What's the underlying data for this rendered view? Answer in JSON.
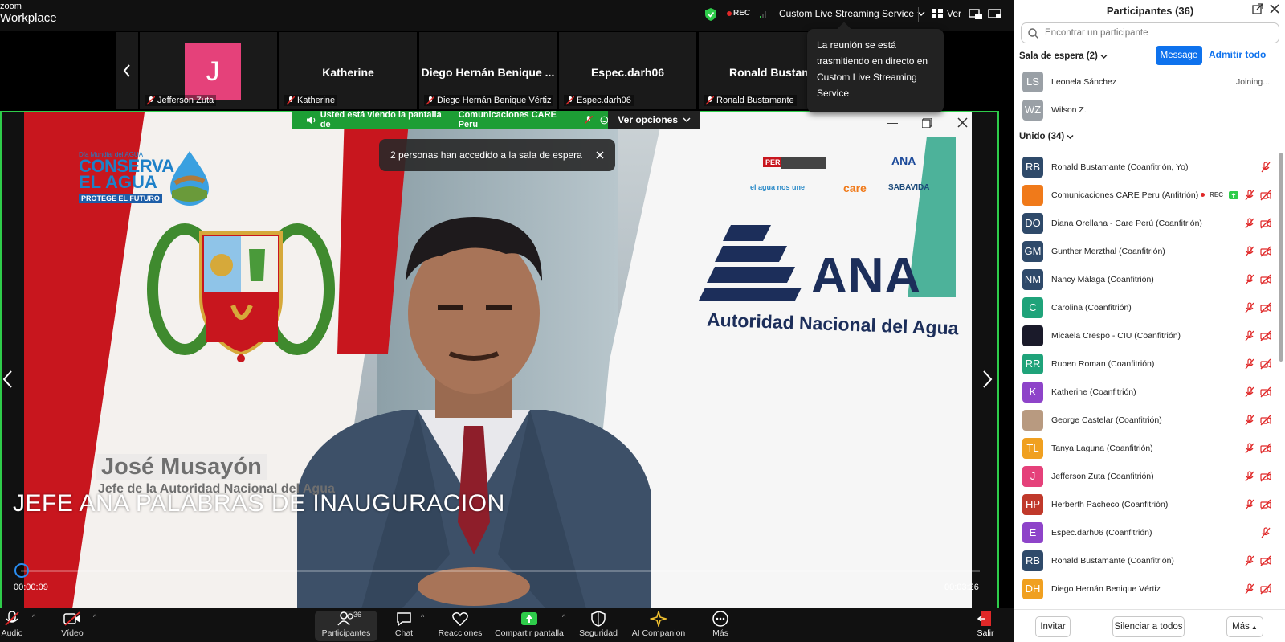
{
  "app": {
    "brand_line1": "zoom",
    "brand_line2": "Workplace"
  },
  "topbar": {
    "rec_label": "REC",
    "stream_label": "Custom Live Streaming Service",
    "view_label": "Ver"
  },
  "strip": {
    "tiles": [
      {
        "initial": "J",
        "label": "Jefferson Zuta"
      },
      {
        "name": "Katherine",
        "label": "Katherine"
      },
      {
        "name": "Diego Hernán Benique ...",
        "label": "Diego Hernán Benique Vértiz"
      },
      {
        "name": "Espec.darh06",
        "label": "Espec.darh06"
      },
      {
        "name": "Ronald Bustama",
        "label": "Ronald Bustamante"
      }
    ]
  },
  "tooltip": {
    "text": "La reunión se está trasmitiendo en directo en Custom Live Streaming Service"
  },
  "share": {
    "viewing_prefix": "Usted está viendo la pantalla de",
    "presenter": "Comunicaciones CARE Peru",
    "options_label": "Ver opciones",
    "toast": "2 personas han accedido a la sala de espera"
  },
  "video": {
    "logo_small": "Día Mundial del AGUA",
    "logo_line1": "CONSERVA",
    "logo_line2": "EL AGUA",
    "logo_line3": "PROTEGE EL FUTURO",
    "sponsor_peru": "PERÚ",
    "sponsor_ana_small": "ANA",
    "sponsor_care": "care",
    "sponsor_sabavida": "SABAVIDA",
    "sponsor_elagua": "el agua nos une",
    "ana_big": "ANA",
    "ana_sub": "Autoridad Nacional del Agua",
    "lower_name": "José Musayón",
    "lower_role": "Jefe de la Autoridad Nacional del Agua",
    "caption": "JEFE ANA PALABRAS DE INAUGURACION",
    "time_current": "00:00:09",
    "time_duration": "00:03:26",
    "progress": 0.0
  },
  "toolbar": {
    "audio": "Audio",
    "video": "Vídeo",
    "participants": "Participantes",
    "participants_count": "36",
    "chat": "Chat",
    "reactions": "Reacciones",
    "share": "Compartir pantalla",
    "security": "Seguridad",
    "companion": "AI Companion",
    "more": "Más",
    "leave": "Salir"
  },
  "sidebar": {
    "title": "Participantes (36)",
    "search_placeholder": "Encontrar un participante",
    "waiting_header": "Sala de espera (2)",
    "message_btn": "Message",
    "admit_all": "Admitir todo",
    "waiting": [
      {
        "initials": "LS",
        "name": "Leonela Sánchez",
        "status": "Joining...",
        "color": "#9aa0a6"
      },
      {
        "initials": "WZ",
        "name": "Wilson Z.",
        "status": "",
        "color": "#9aa0a6"
      }
    ],
    "joined_header": "Unido (34)",
    "joined": [
      {
        "initials": "RB",
        "name": "Ronald Bustamante (Coanfitrión, Yo)",
        "color": "#2f4a6a",
        "video_off": false
      },
      {
        "initials": "",
        "name": "Comunicaciones CARE Peru (Anfitrión)",
        "color": "#f07a1a",
        "rec": "REC"
      },
      {
        "initials": "DO",
        "name": "Diana Orellana - Care Perú (Coanfitrión)",
        "color": "#2f4a6a"
      },
      {
        "initials": "GM",
        "name": "Gunther Merzthal (Coanfitrión)",
        "color": "#2f4a6a"
      },
      {
        "initials": "NM",
        "name": "Nancy Málaga (Coanfitrión)",
        "color": "#2f4a6a"
      },
      {
        "initials": "C",
        "name": "Carolina (Coanfitrión)",
        "color": "#1fa37a"
      },
      {
        "initials": "",
        "name": "Micaela Crespo - CIU (Coanfitrión)",
        "color": "#1a1a2a"
      },
      {
        "initials": "RR",
        "name": "Ruben Roman (Coanfitrión)",
        "color": "#1fa37a"
      },
      {
        "initials": "K",
        "name": "Katherine (Coanfitrión)",
        "color": "#8e44c9"
      },
      {
        "initials": "",
        "name": "George Castelar (Coanfitrión)",
        "color": "#b89a80"
      },
      {
        "initials": "TL",
        "name": "Tanya Laguna (Coanfitrión)",
        "color": "#f0a020"
      },
      {
        "initials": "J",
        "name": "Jefferson Zuta (Coanfitrión)",
        "color": "#e5417a"
      },
      {
        "initials": "HP",
        "name": "Herberth Pacheco (Coanfitrión)",
        "color": "#c0392b"
      },
      {
        "initials": "E",
        "name": "Espec.darh06 (Coanfitrión)",
        "color": "#8e44c9",
        "video_off": false
      },
      {
        "initials": "RB",
        "name": "Ronald Bustamante (Coanfitrión)",
        "color": "#2f4a6a"
      },
      {
        "initials": "DH",
        "name": "Diego Hernán Benique Vértiz",
        "color": "#f0a020"
      }
    ],
    "invite": "Invitar",
    "mute_all": "Silenciar a todos",
    "more": "Más"
  }
}
